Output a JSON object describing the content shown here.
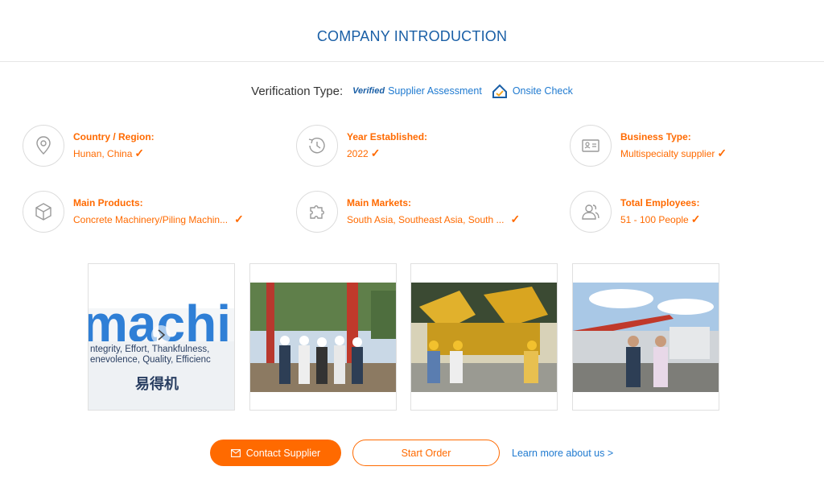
{
  "header": {
    "title": "COMPANY INTRODUCTION"
  },
  "verification": {
    "label": "Verification Type:",
    "verified_logo": "Verified",
    "supplier_assessment": "Supplier Assessment",
    "onsite_check": "Onsite Check"
  },
  "info": {
    "country": {
      "label": "Country / Region:",
      "value": "Hunan, China"
    },
    "year": {
      "label": "Year Established:",
      "value": "2022"
    },
    "business": {
      "label": "Business Type:",
      "value": "Multispecialty supplier"
    },
    "products": {
      "label": "Main Products:",
      "value": "Concrete Machinery/Piling Machin..."
    },
    "markets": {
      "label": "Main Markets:",
      "value": "South Asia, Southeast Asia, South ..."
    },
    "employees": {
      "label": "Total Employees:",
      "value": "51 - 100 People"
    }
  },
  "photo1": {
    "sign_text": "machin",
    "line1": "ntegrity, Effort, Thankfulness,",
    "line2": "enevolence, Quality, Efficienc",
    "chinese": "易得机"
  },
  "actions": {
    "contact": "Contact Supplier",
    "order": "Start Order",
    "learn_more": "Learn more about us >"
  },
  "colors": {
    "accent": "#ff6a00",
    "title_blue": "#1a5fa6",
    "link_blue": "#1f7ad0"
  },
  "check_mark": "✓"
}
